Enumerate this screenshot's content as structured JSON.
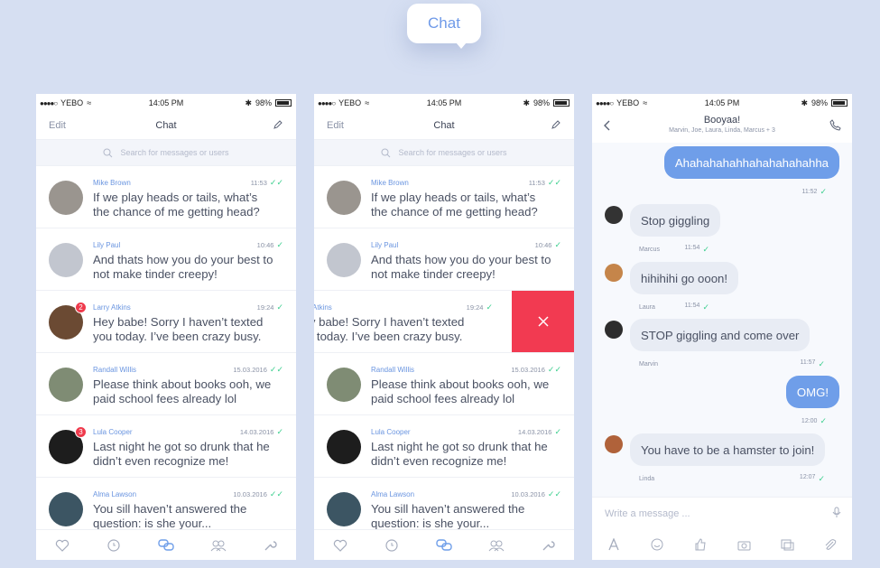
{
  "header_label": "Chat",
  "status": {
    "carrier": "YEBO",
    "time": "14:05 PM",
    "battery": "98%"
  },
  "list_nav": {
    "edit": "Edit",
    "title": "Chat"
  },
  "search": {
    "placeholder": "Search for messages or users"
  },
  "conversations": [
    {
      "name": "Mike Brown",
      "time": "11:53",
      "message_1": "If we play heads or tails, what’s",
      "message_2": "the chance of me getting head?",
      "badge": "",
      "avatar_color": "#9a958f"
    },
    {
      "name": "Lily Paul",
      "time": "10:46",
      "message_1": "And thats how you do your best to",
      "message_2": "not make tinder creepy!",
      "badge": "",
      "avatar_color": "#c2c6cf"
    },
    {
      "name": "Larry Atkins",
      "time": "19:24",
      "message_1": "Hey babe! Sorry I haven’t texted",
      "message_2": "you today. I’ve been crazy busy.",
      "badge": "2",
      "avatar_color": "#6b4a33"
    },
    {
      "name": "Randall Willis",
      "time": "15.03.2016",
      "message_1": "Please think about books ooh, we",
      "message_2": "paid school fees already lol",
      "badge": "",
      "avatar_color": "#7f8c74"
    },
    {
      "name": "Lula Cooper",
      "time": "14.03.2016",
      "message_1": "Last night he got so drunk that he",
      "message_2": "didn’t even recognize me!",
      "badge": "3",
      "avatar_color": "#1d1d1d"
    },
    {
      "name": "Alma Lawson",
      "time": "10.03.2016",
      "message_1": "You sill haven’t answered the",
      "message_2": "question: is she your...",
      "badge": "",
      "avatar_color": "#3c5563"
    }
  ],
  "conversation": {
    "title": "Booyaa!",
    "members": "Marvin, Joe, Laura, Linda, Marcus + 3",
    "messages": [
      {
        "direction": "out",
        "text": "Ahahahahahhahahahahahha",
        "sender": "",
        "time": "11:52"
      },
      {
        "direction": "in",
        "text": "Stop giggling",
        "sender": "Marcus",
        "time": "11:54"
      },
      {
        "direction": "in",
        "text": "hihihihi go ooon!",
        "sender": "Laura",
        "time": "11:54"
      },
      {
        "direction": "in",
        "text": "STOP giggling and come over",
        "sender": "Marvin",
        "time": "11:57"
      },
      {
        "direction": "out",
        "text": "OMG!",
        "sender": "",
        "time": "12:00"
      },
      {
        "direction": "in",
        "text": "You have to be a hamster to join!",
        "sender": "Linda",
        "time": "12:07"
      }
    ],
    "composer_placeholder": "Write a message ..."
  },
  "colors": {
    "accent": "#6f9ee9",
    "delete": "#f23a51",
    "check": "#3ccf8e",
    "background": "#d6dff2"
  }
}
